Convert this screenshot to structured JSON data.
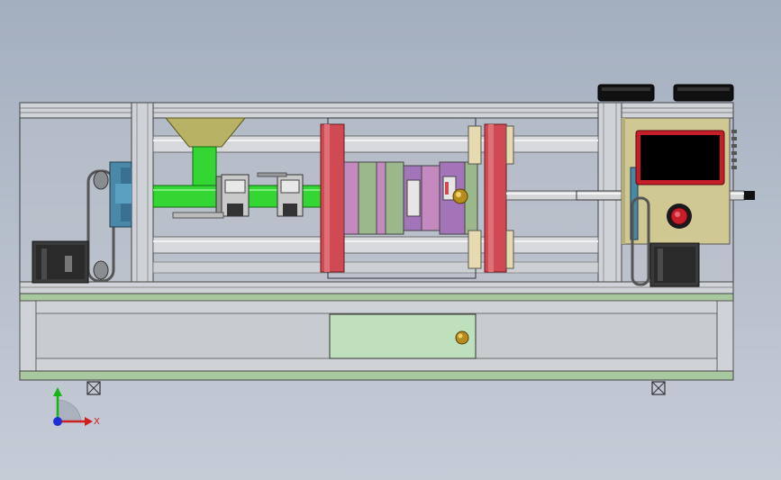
{
  "view": {
    "background_top": "#a3aebf",
    "background_bottom": "#c6ccd6"
  },
  "triad": {
    "x_label": "X",
    "x_color": "#d11f1f",
    "y_color": "#17b317",
    "z_color": "#1f2fd1"
  },
  "colors": {
    "frame": "#c9ccd0",
    "platen_red": "#cf4a52",
    "barrel_green": "#33d633",
    "hopper_olive": "#b7b264",
    "motor_blue": "#4a88a8",
    "control_panel": "#cfc892",
    "screen_red": "#c81e2a",
    "base_green": "#a8c8a0",
    "mold_violet": "#a374b8",
    "mold_pink": "#c48ac0",
    "mold_sage": "#9ab88a"
  }
}
